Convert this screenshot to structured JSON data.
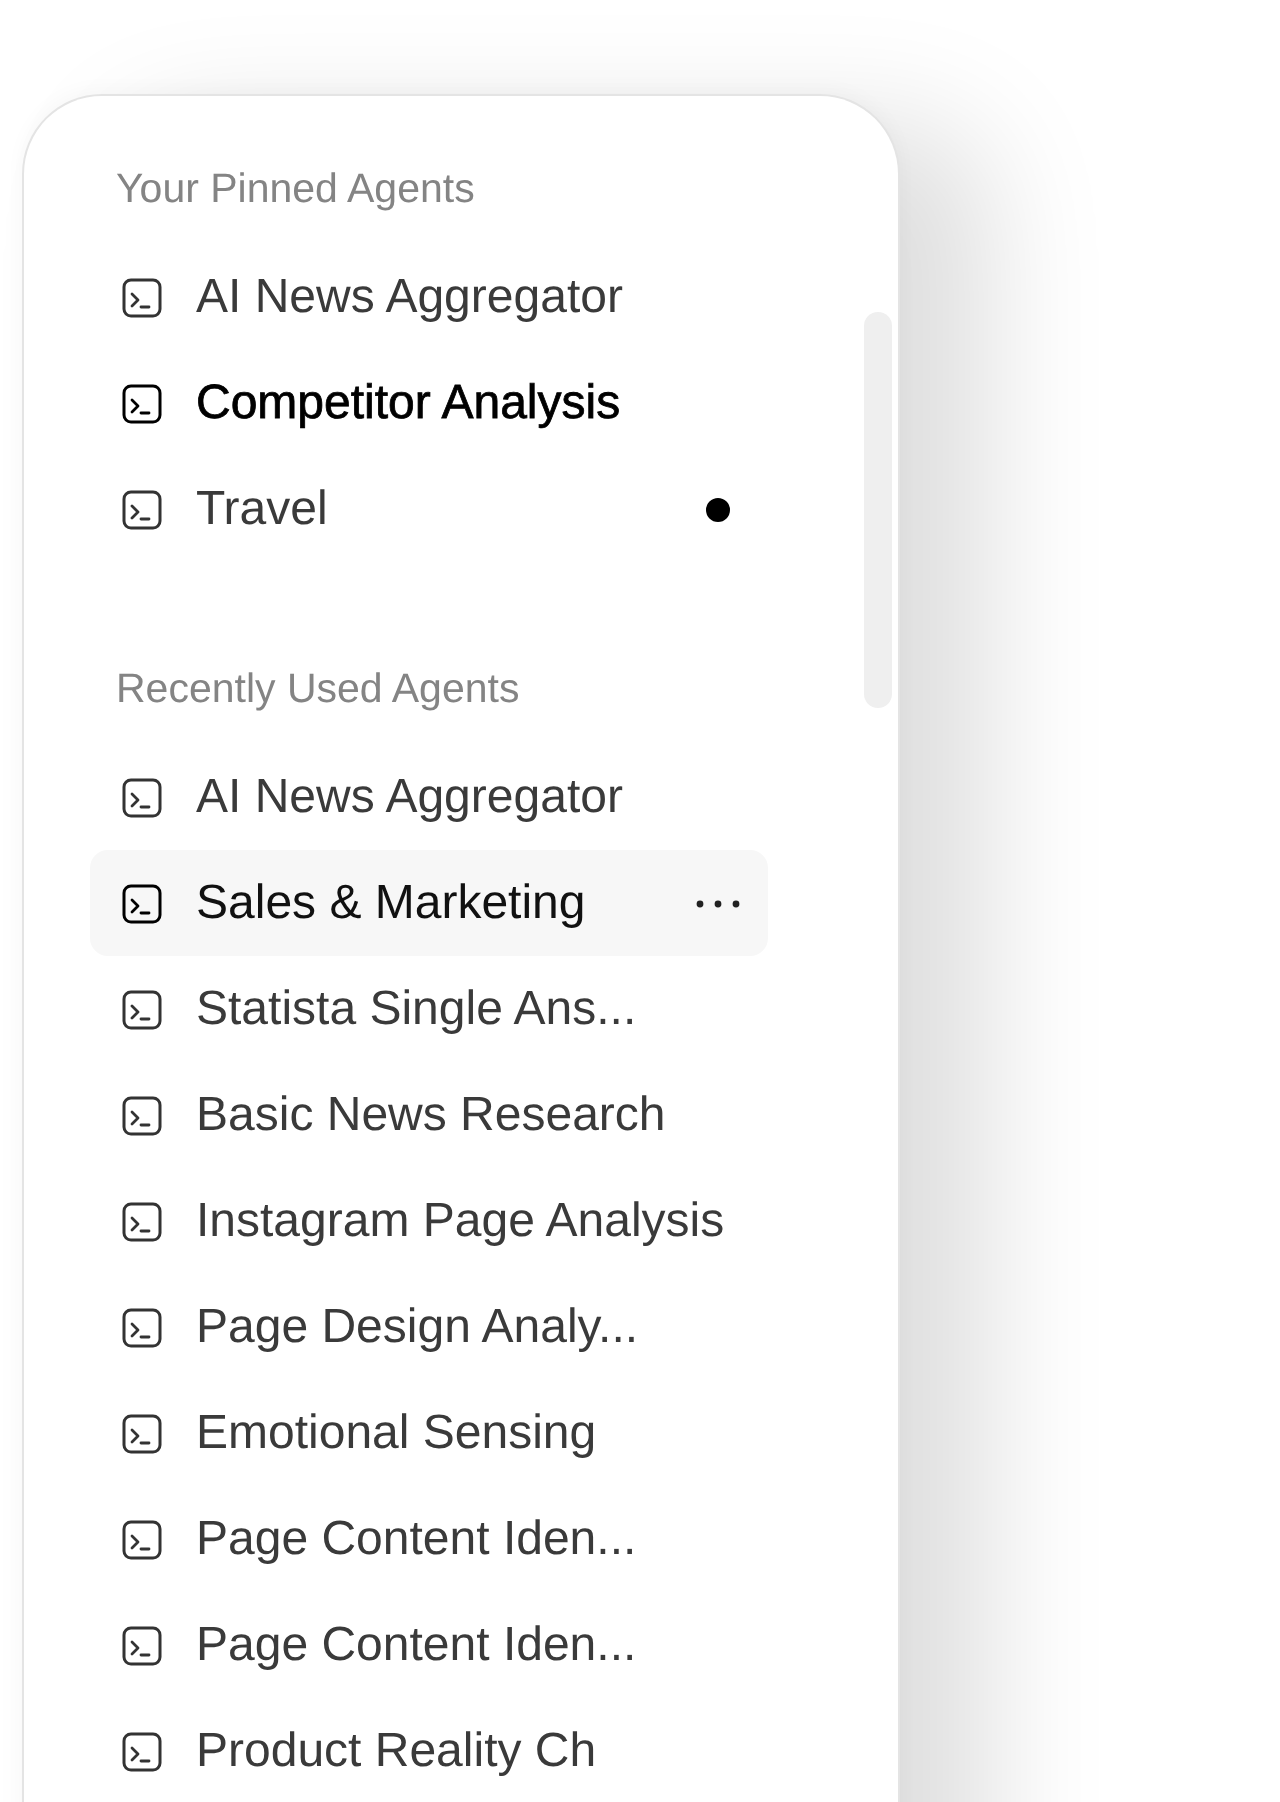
{
  "pinned": {
    "heading": "Your Pinned Agents",
    "items": [
      {
        "label": "AI News Aggregator",
        "selected": false,
        "unread": false
      },
      {
        "label": "Competitor Analysis",
        "selected": true,
        "unread": false
      },
      {
        "label": "Travel",
        "selected": false,
        "unread": true
      }
    ]
  },
  "recent": {
    "heading": "Recently Used Agents",
    "items": [
      {
        "label": "AI News Aggregator",
        "selected": false,
        "hovered": false
      },
      {
        "label": "Sales & Marketing",
        "selected": false,
        "hovered": true
      },
      {
        "label": "Statista Single Ans...",
        "selected": false,
        "hovered": false
      },
      {
        "label": "Basic News Research",
        "selected": false,
        "hovered": false
      },
      {
        "label": "Instagram Page Analysis",
        "selected": false,
        "hovered": false
      },
      {
        "label": "Page Design Analy...",
        "selected": false,
        "hovered": false
      },
      {
        "label": "Emotional Sensing",
        "selected": false,
        "hovered": false
      },
      {
        "label": "Page Content Iden...",
        "selected": false,
        "hovered": false
      },
      {
        "label": "Page Content Iden...",
        "selected": false,
        "hovered": false
      },
      {
        "label": "Product Reality Ch",
        "selected": false,
        "hovered": false
      }
    ]
  }
}
